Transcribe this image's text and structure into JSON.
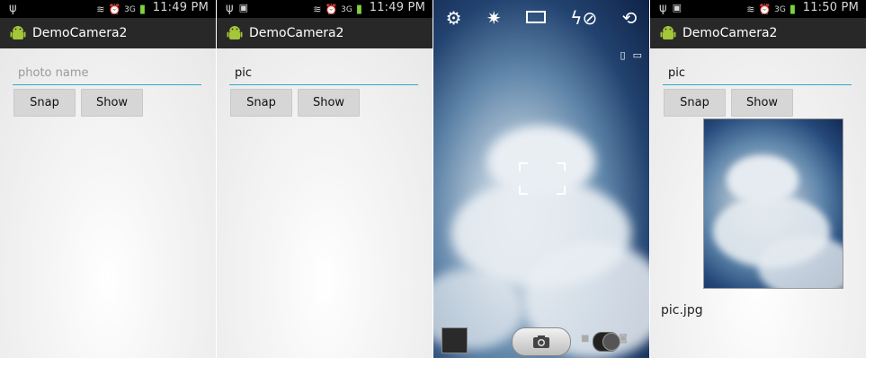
{
  "screens": [
    {
      "status": {
        "time": "11:49 PM"
      },
      "app_title": "DemoCamera2",
      "input": {
        "value": "",
        "placeholder": "photo name"
      },
      "buttons": {
        "snap": "Snap",
        "show": "Show"
      }
    },
    {
      "status": {
        "time": "11:49 PM"
      },
      "app_title": "DemoCamera2",
      "input": {
        "value": "pic",
        "placeholder": "photo name"
      },
      "buttons": {
        "snap": "Snap",
        "show": "Show"
      }
    },
    {
      "camera": {
        "top_icons": [
          "settings-icon",
          "exposure-icon",
          "aspect-ratio-icon",
          "flash-off-icon",
          "switch-camera-icon"
        ],
        "side_icons": [
          "storage-phone-icon",
          "storage-card-icon"
        ],
        "bottom": [
          "gallery-thumbnail",
          "shutter-button",
          "camera-video-toggle"
        ]
      }
    },
    {
      "status": {
        "time": "11:50 PM"
      },
      "app_title": "DemoCamera2",
      "input": {
        "value": "pic",
        "placeholder": "photo name"
      },
      "buttons": {
        "snap": "Snap",
        "show": "Show"
      },
      "filename": "pic.jpg"
    }
  ],
  "colors": {
    "status_bar": "#000000",
    "title_bar": "#282828",
    "input_underline": "#32a8c9",
    "button_bg": "#d6d6d6"
  }
}
